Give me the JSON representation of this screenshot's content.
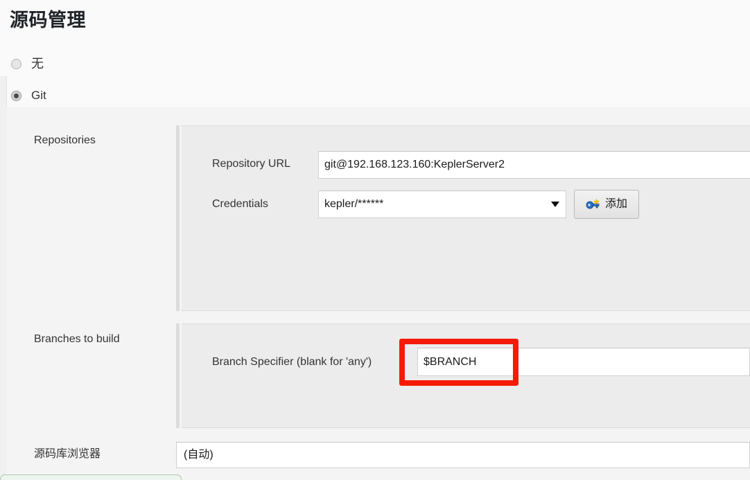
{
  "section": {
    "title": "源码管理"
  },
  "scm_options": [
    {
      "label": "无",
      "selected": false,
      "name": "radio-none"
    },
    {
      "label": "Git",
      "selected": true,
      "name": "radio-git"
    }
  ],
  "rows": {
    "repositories_label": "Repositories",
    "branches_label": "Branches to build",
    "browser_label": "源码库浏览器"
  },
  "repository": {
    "url_label": "Repository URL",
    "url_value": "git@192.168.123.160:KeplerServer2",
    "credentials_label": "Credentials",
    "credentials_value": "kepler/******",
    "add_button_label": "添加",
    "add_button_icon": "key-icon",
    "dropdown_icon": "chevron-down-icon"
  },
  "branches": {
    "specifier_label": "Branch Specifier (blank for 'any')",
    "specifier_value": "$BRANCH"
  },
  "browser": {
    "value": "(自动)"
  },
  "colors": {
    "page_background": "#fafafa",
    "form_background": "#f4f4f4",
    "panel_background": "#ececec",
    "panel_bar": "#dcdcdc",
    "input_background": "#ffffff",
    "input_border": "#d0d0d0",
    "text": "#333333",
    "title_text": "#1f2328",
    "annotation_red": "#f51b07",
    "key_icon_blue": "#2b72c6",
    "key_icon_yellow": "#f5c518",
    "bottom_bar_green": "#aec7ae"
  }
}
